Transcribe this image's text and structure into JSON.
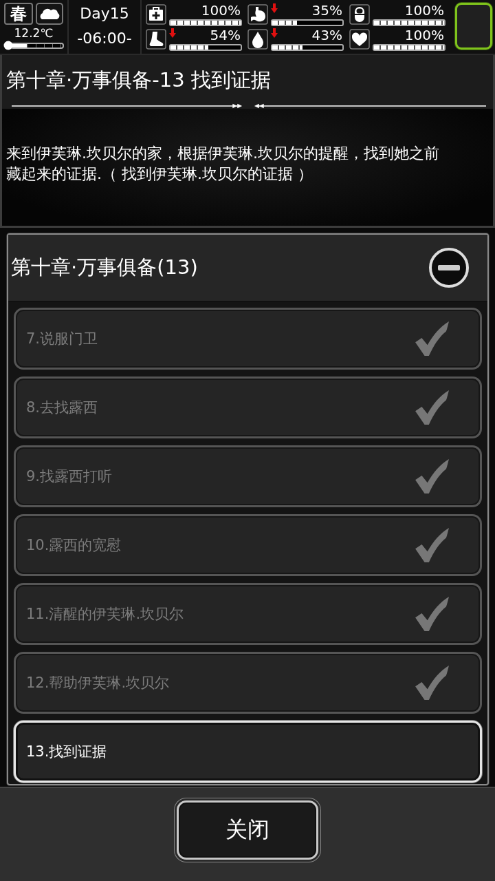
{
  "weather": {
    "season": "春",
    "temperature": "12.2℃",
    "level": 0.3
  },
  "clock": {
    "day": "Day15",
    "time": "-06:00-"
  },
  "stats": [
    {
      "kind": "health",
      "value": "100%",
      "level": 1,
      "falling": false
    },
    {
      "kind": "stomach",
      "value": "35%",
      "level": 0.35,
      "falling": true
    },
    {
      "kind": "pill",
      "value": "100%",
      "level": 1,
      "falling": false
    },
    {
      "kind": "foot",
      "value": "54%",
      "level": 0.54,
      "falling": true
    },
    {
      "kind": "water",
      "value": "43%",
      "level": 0.43,
      "falling": true
    },
    {
      "kind": "heart",
      "value": "100%",
      "level": 1,
      "falling": false
    }
  ],
  "quest": {
    "title": "第十章·万事俱备-13 找到证据",
    "description": "来到伊芙琳.坎贝尔的家，根据伊芙琳.坎贝尔的提醒，找到她之前藏起来的证据.（ 找到伊芙琳.坎贝尔的证据 ）"
  },
  "chapter": {
    "title": "第十章·万事俱备(13)",
    "expanded": true,
    "items": [
      {
        "label": "7.说服门卫",
        "completed": true,
        "selected": false
      },
      {
        "label": "8.去找露西",
        "completed": true,
        "selected": false
      },
      {
        "label": "9.找露西打听",
        "completed": true,
        "selected": false
      },
      {
        "label": "10.露西的宽慰",
        "completed": true,
        "selected": false
      },
      {
        "label": "11.清醒的伊芙琳.坎贝尔",
        "completed": true,
        "selected": false
      },
      {
        "label": "12.帮助伊芙琳.坎贝尔",
        "completed": true,
        "selected": false
      },
      {
        "label": "13.找到证据",
        "completed": false,
        "selected": true
      }
    ]
  },
  "close_button": "关闭"
}
